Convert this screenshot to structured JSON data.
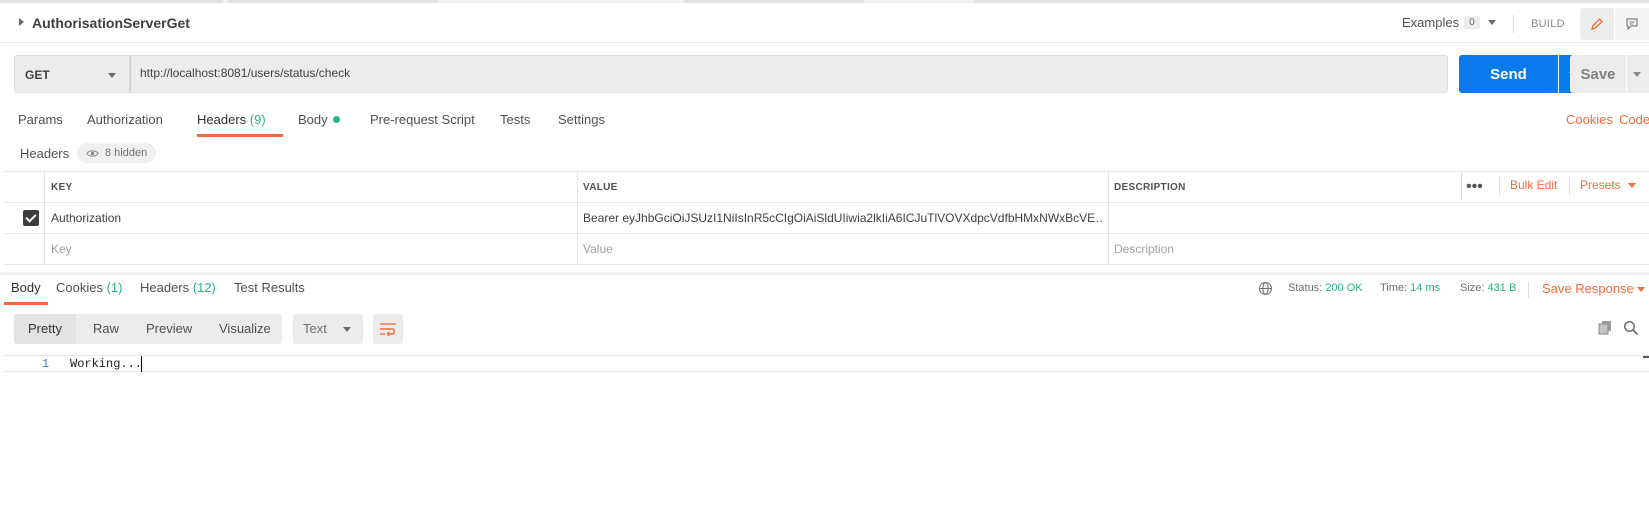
{
  "request": {
    "name": "AuthorisationServerGet",
    "examples_label": "Examples",
    "examples_count": "0",
    "build_label": "BUILD",
    "method": "GET",
    "url": "http://localhost:8081/users/status/check",
    "send_label": "Send",
    "save_label": "Save"
  },
  "request_tabs": {
    "params": "Params",
    "authorization": "Authorization",
    "headers": "Headers",
    "headers_count": "(9)",
    "body": "Body",
    "prerequest": "Pre-request Script",
    "tests": "Tests",
    "settings": "Settings",
    "cookies": "Cookies",
    "code": "Code"
  },
  "headers_section": {
    "label": "Headers",
    "hidden": "8 hidden",
    "col_key": "KEY",
    "col_value": "VALUE",
    "col_description": "DESCRIPTION",
    "bulk_edit": "Bulk Edit",
    "presets": "Presets",
    "rows": [
      {
        "checked": true,
        "key": "Authorization",
        "value": "Bearer eyJhbGciOiJSUzI1NiIsInR5cCIgOiAiSldUIiwia2lkIiA6ICJuTlVOVXdpcVdfbHMxNWxBcVE…",
        "description": ""
      }
    ],
    "new_row": {
      "key_placeholder": "Key",
      "value_placeholder": "Value",
      "description_placeholder": "Description"
    }
  },
  "response": {
    "tabs": {
      "body": "Body",
      "cookies": "Cookies",
      "cookies_count": "(1)",
      "headers": "Headers",
      "headers_count": "(12)",
      "test_results": "Test Results"
    },
    "status_label": "Status:",
    "status_value": "200 OK",
    "time_label": "Time:",
    "time_value": "14 ms",
    "size_label": "Size:",
    "size_value": "431 B",
    "save_response": "Save Response",
    "formats": [
      "Pretty",
      "Raw",
      "Preview",
      "Visualize"
    ],
    "active_format": "Pretty",
    "language": "Text",
    "body_lines": [
      {
        "no": "1",
        "text": "Working..."
      }
    ]
  },
  "colors": {
    "accent_orange": "#f26b3a",
    "send_blue": "#097bed",
    "status_green": "#26b47f"
  }
}
